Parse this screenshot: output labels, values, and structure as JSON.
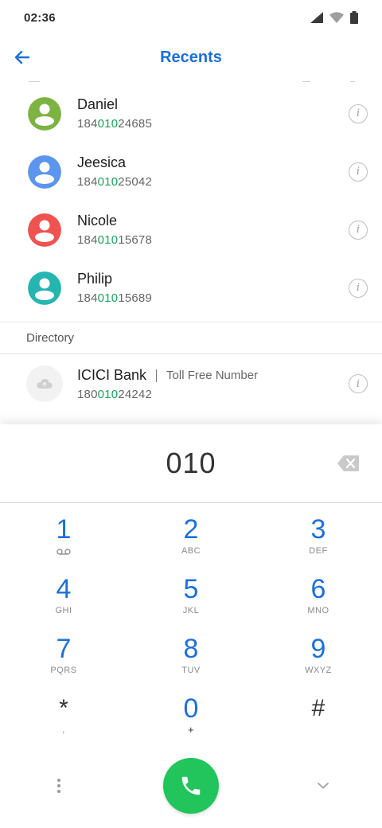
{
  "status_bar": {
    "time": "02:36"
  },
  "app_bar": {
    "title": "Recents"
  },
  "contacts": [
    {
      "name": "Daniel",
      "number_prefix": "184",
      "number_match": "010",
      "number_suffix": "24685",
      "avatar_color": "#7cb342"
    },
    {
      "name": "Jeesica",
      "number_prefix": "184",
      "number_match": "010",
      "number_suffix": "25042",
      "avatar_color": "#5c95f0"
    },
    {
      "name": "Nicole",
      "number_prefix": "184",
      "number_match": "010",
      "number_suffix": "15678",
      "avatar_color": "#ef5350"
    },
    {
      "name": "Philip",
      "number_prefix": "184",
      "number_match": "010",
      "number_suffix": "15689",
      "avatar_color": "#26b5b0"
    }
  ],
  "directory": {
    "header": "Directory",
    "entry": {
      "name": "ICICI Bank",
      "tag": "Toll Free Number",
      "number_prefix": "180",
      "number_match": "010",
      "number_suffix": "24242"
    }
  },
  "dialpad": {
    "digits": "010",
    "keys": [
      {
        "num": "1",
        "sub": ""
      },
      {
        "num": "2",
        "sub": "ABC"
      },
      {
        "num": "3",
        "sub": "DEF"
      },
      {
        "num": "4",
        "sub": "GHI"
      },
      {
        "num": "5",
        "sub": "JKL"
      },
      {
        "num": "6",
        "sub": "MNO"
      },
      {
        "num": "7",
        "sub": "PQRS"
      },
      {
        "num": "8",
        "sub": "TUV"
      },
      {
        "num": "9",
        "sub": "WXYZ"
      },
      {
        "num": "*",
        "sub": ","
      },
      {
        "num": "0",
        "sub": "+"
      },
      {
        "num": "#",
        "sub": ""
      }
    ]
  },
  "colors": {
    "accent": "#1d6fd8",
    "match": "#1aa45a",
    "call": "#21c55b"
  },
  "icons": {
    "back": "arrow-left-icon",
    "info": "info-icon",
    "backspace": "backspace-icon",
    "call": "phone-icon",
    "more": "more-vertical-icon",
    "collapse": "chevron-down-icon",
    "voicemail": "voicemail-icon",
    "cloud": "cloud-icon"
  }
}
